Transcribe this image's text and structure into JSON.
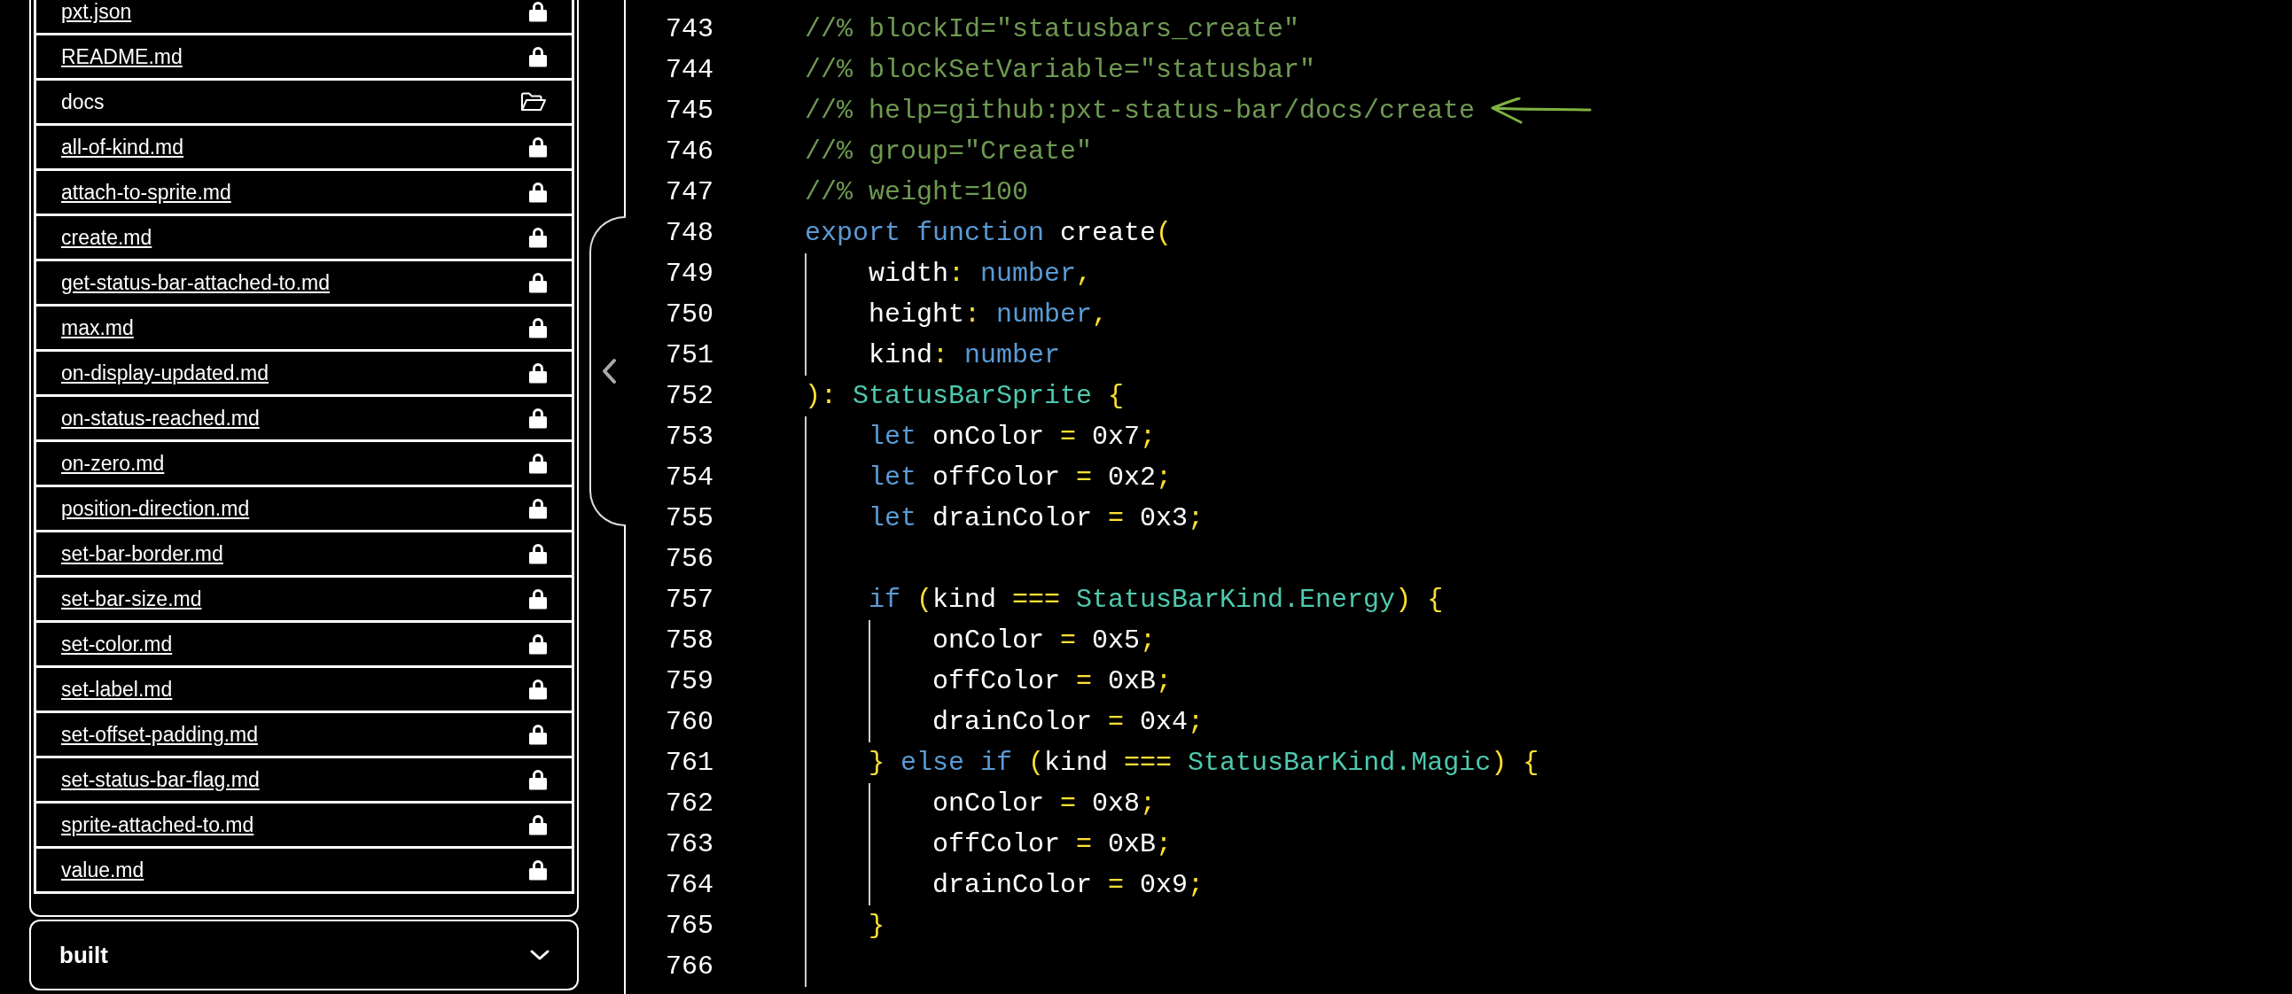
{
  "sidebar": {
    "files": [
      {
        "name": "pxt.json",
        "kind": "file"
      },
      {
        "name": "README.md",
        "kind": "file"
      },
      {
        "name": "docs",
        "kind": "folder"
      },
      {
        "name": "all-of-kind.md",
        "kind": "file"
      },
      {
        "name": "attach-to-sprite.md",
        "kind": "file"
      },
      {
        "name": "create.md",
        "kind": "file"
      },
      {
        "name": "get-status-bar-attached-to.md",
        "kind": "file"
      },
      {
        "name": "max.md",
        "kind": "file"
      },
      {
        "name": "on-display-updated.md",
        "kind": "file"
      },
      {
        "name": "on-status-reached.md",
        "kind": "file"
      },
      {
        "name": "on-zero.md",
        "kind": "file"
      },
      {
        "name": "position-direction.md",
        "kind": "file"
      },
      {
        "name": "set-bar-border.md",
        "kind": "file"
      },
      {
        "name": "set-bar-size.md",
        "kind": "file"
      },
      {
        "name": "set-color.md",
        "kind": "file"
      },
      {
        "name": "set-label.md",
        "kind": "file"
      },
      {
        "name": "set-offset-padding.md",
        "kind": "file"
      },
      {
        "name": "set-status-bar-flag.md",
        "kind": "file"
      },
      {
        "name": "sprite-attached-to.md",
        "kind": "file"
      },
      {
        "name": "value.md",
        "kind": "file"
      }
    ],
    "sections": [
      {
        "title": "built",
        "expanded": false
      }
    ]
  },
  "code": {
    "lines": [
      {
        "number": "743",
        "tokens": [
          {
            "text": "//% blockId=\"statusbars_create\"",
            "kind": "comment"
          }
        ]
      },
      {
        "number": "744",
        "tokens": [
          {
            "text": "//% blockSetVariable=\"statusbar\"",
            "kind": "comment"
          }
        ]
      },
      {
        "number": "745",
        "annotation": {
          "kind": "arrow"
        },
        "tokens": [
          {
            "text": "//% help=github:pxt-status-bar/docs/create",
            "kind": "comment"
          }
        ]
      },
      {
        "number": "746",
        "tokens": [
          {
            "text": "//% group=\"Create\"",
            "kind": "comment"
          }
        ]
      },
      {
        "number": "747",
        "tokens": [
          {
            "text": "//% weight=100",
            "kind": "comment"
          }
        ]
      },
      {
        "number": "748",
        "tokens": [
          {
            "text": "export function",
            "kind": "keyword"
          },
          {
            "text": " create",
            "kind": "plain"
          },
          {
            "text": "(",
            "kind": "punct"
          }
        ],
        "children": [
          {
            "number": "749",
            "tokens": [
              {
                "text": "width",
                "kind": "plain"
              },
              {
                "text": ": ",
                "kind": "punct"
              },
              {
                "text": "number",
                "kind": "keyword"
              },
              {
                "text": ",",
                "kind": "punct"
              }
            ]
          },
          {
            "number": "750",
            "tokens": [
              {
                "text": "height",
                "kind": "plain"
              },
              {
                "text": ": ",
                "kind": "punct"
              },
              {
                "text": "number",
                "kind": "keyword"
              },
              {
                "text": ",",
                "kind": "punct"
              }
            ]
          },
          {
            "number": "751",
            "tokens": [
              {
                "text": "kind",
                "kind": "plain"
              },
              {
                "text": ": ",
                "kind": "punct"
              },
              {
                "text": "number",
                "kind": "keyword"
              }
            ]
          }
        ]
      },
      {
        "number": "752",
        "tokens": [
          {
            "text": "): ",
            "kind": "punct"
          },
          {
            "text": "StatusBarSprite",
            "kind": "type"
          },
          {
            "text": " {",
            "kind": "punct"
          }
        ],
        "children": [
          {
            "number": "753",
            "tokens": [
              {
                "text": "let",
                "kind": "keyword"
              },
              {
                "text": " onColor ",
                "kind": "plain"
              },
              {
                "text": "=",
                "kind": "punct"
              },
              {
                "text": " 0x7",
                "kind": "plain"
              },
              {
                "text": ";",
                "kind": "punct"
              }
            ]
          },
          {
            "number": "754",
            "tokens": [
              {
                "text": "let",
                "kind": "keyword"
              },
              {
                "text": " offColor ",
                "kind": "plain"
              },
              {
                "text": "=",
                "kind": "punct"
              },
              {
                "text": " 0x2",
                "kind": "plain"
              },
              {
                "text": ";",
                "kind": "punct"
              }
            ]
          },
          {
            "number": "755",
            "tokens": [
              {
                "text": "let",
                "kind": "keyword"
              },
              {
                "text": " drainColor ",
                "kind": "plain"
              },
              {
                "text": "=",
                "kind": "punct"
              },
              {
                "text": " 0x3",
                "kind": "plain"
              },
              {
                "text": ";",
                "kind": "punct"
              }
            ]
          },
          {
            "number": "756"
          },
          {
            "number": "757",
            "tokens": [
              {
                "text": "if",
                "kind": "keyword"
              },
              {
                "text": " (",
                "kind": "punct"
              },
              {
                "text": "kind ",
                "kind": "plain"
              },
              {
                "text": "===",
                "kind": "punct"
              },
              {
                "text": " StatusBarKind.Energy",
                "kind": "type"
              },
              {
                "text": ") {",
                "kind": "punct"
              }
            ],
            "children": [
              {
                "number": "758",
                "tokens": [
                  {
                    "text": "onColor ",
                    "kind": "plain"
                  },
                  {
                    "text": "=",
                    "kind": "punct"
                  },
                  {
                    "text": " 0x5",
                    "kind": "plain"
                  },
                  {
                    "text": ";",
                    "kind": "punct"
                  }
                ]
              },
              {
                "number": "759",
                "tokens": [
                  {
                    "text": "offColor ",
                    "kind": "plain"
                  },
                  {
                    "text": "=",
                    "kind": "punct"
                  },
                  {
                    "text": " 0xB",
                    "kind": "plain"
                  },
                  {
                    "text": ";",
                    "kind": "punct"
                  }
                ]
              },
              {
                "number": "760",
                "tokens": [
                  {
                    "text": "drainColor ",
                    "kind": "plain"
                  },
                  {
                    "text": "=",
                    "kind": "punct"
                  },
                  {
                    "text": " 0x4",
                    "kind": "plain"
                  },
                  {
                    "text": ";",
                    "kind": "punct"
                  }
                ]
              }
            ]
          },
          {
            "number": "761",
            "tokens": [
              {
                "text": "}",
                "kind": "punct"
              },
              {
                "text": " else if",
                "kind": "keyword"
              },
              {
                "text": " (",
                "kind": "punct"
              },
              {
                "text": "kind ",
                "kind": "plain"
              },
              {
                "text": "===",
                "kind": "punct"
              },
              {
                "text": " StatusBarKind.Magic",
                "kind": "type"
              },
              {
                "text": ") {",
                "kind": "punct"
              }
            ],
            "children": [
              {
                "number": "762",
                "tokens": [
                  {
                    "text": "onColor ",
                    "kind": "plain"
                  },
                  {
                    "text": "=",
                    "kind": "punct"
                  },
                  {
                    "text": " 0x8",
                    "kind": "plain"
                  },
                  {
                    "text": ";",
                    "kind": "punct"
                  }
                ]
              },
              {
                "number": "763",
                "tokens": [
                  {
                    "text": "offColor ",
                    "kind": "plain"
                  },
                  {
                    "text": "=",
                    "kind": "punct"
                  },
                  {
                    "text": " 0xB",
                    "kind": "plain"
                  },
                  {
                    "text": ";",
                    "kind": "punct"
                  }
                ]
              },
              {
                "number": "764",
                "tokens": [
                  {
                    "text": "drainColor ",
                    "kind": "plain"
                  },
                  {
                    "text": "=",
                    "kind": "punct"
                  },
                  {
                    "text": " 0x9",
                    "kind": "plain"
                  },
                  {
                    "text": ";",
                    "kind": "punct"
                  }
                ]
              }
            ]
          },
          {
            "number": "765",
            "tokens": [
              {
                "text": "}",
                "kind": "punct"
              }
            ]
          },
          {
            "number": "766"
          }
        ]
      }
    ]
  }
}
